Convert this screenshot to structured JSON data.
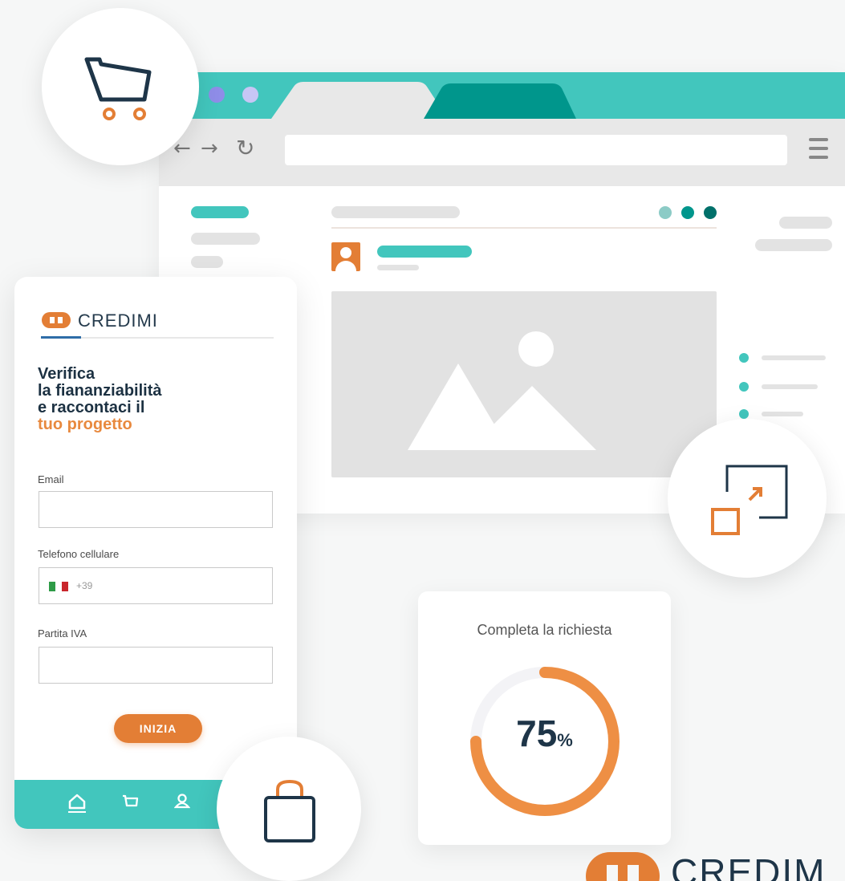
{
  "colors": {
    "accent_teal": "#42c6bd",
    "dark_teal": "#00968c",
    "brand_orange": "#e37e35",
    "navy": "#1e3548"
  },
  "phone": {
    "brand": "CREDIMI",
    "headline_line1": "Verifica",
    "headline_line2": "la fiananziabilità",
    "headline_line3": "e raccontaci il",
    "headline_line4": "tuo progetto",
    "email_label": "Email",
    "email_value": "",
    "phone_label": "Telefono cellulare",
    "phone_prefix": "+39",
    "vat_label": "Partita IVA",
    "vat_value": "",
    "cta_label": "INIZIA",
    "bottom_nav": [
      "home-icon",
      "cart-icon",
      "user-icon"
    ]
  },
  "progress_card": {
    "title": "Completa la richiesta",
    "value": "75",
    "unit": "%",
    "fraction": 0.75
  },
  "footer_logo": {
    "text": "CREDIM"
  },
  "icons": {
    "top_circle": "shopping-cart-icon",
    "right_circle": "expand-icon",
    "bottom_circle": "shopping-bag-icon"
  }
}
